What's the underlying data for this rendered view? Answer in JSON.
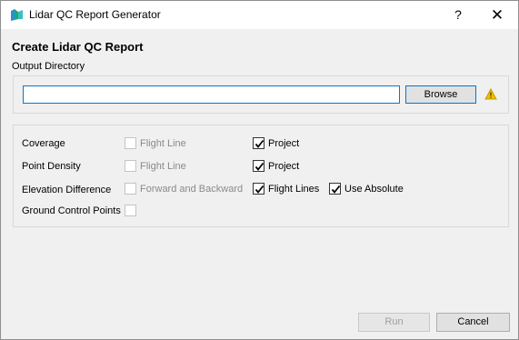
{
  "window": {
    "title": "Lidar QC Report Generator",
    "help_glyph": "?",
    "close_glyph": "✕"
  },
  "form": {
    "heading": "Create Lidar QC Report",
    "output_directory_label": "Output Directory",
    "output_directory_value": "",
    "browse_label": "Browse"
  },
  "rows": [
    {
      "label": "Coverage",
      "options": [
        {
          "label": "Flight Line",
          "checked": false,
          "enabled": false
        },
        {
          "label": "Project",
          "checked": true,
          "enabled": true
        }
      ]
    },
    {
      "label": "Point Density",
      "options": [
        {
          "label": "Flight Line",
          "checked": false,
          "enabled": false
        },
        {
          "label": "Project",
          "checked": true,
          "enabled": true
        }
      ]
    },
    {
      "label": "Elevation Difference",
      "options": [
        {
          "label": "Forward and Backward",
          "checked": false,
          "enabled": false
        },
        {
          "label": "Flight Lines",
          "checked": true,
          "enabled": true
        },
        {
          "label": "Use Absolute",
          "checked": true,
          "enabled": true
        }
      ]
    },
    {
      "label": "Ground Control Points",
      "options": [
        {
          "label": "",
          "checked": false,
          "enabled": false
        }
      ]
    }
  ],
  "footer": {
    "run_label": "Run",
    "cancel_label": "Cancel"
  },
  "colors": {
    "focus_border": "#0078d7",
    "warning": "#f0c000"
  }
}
